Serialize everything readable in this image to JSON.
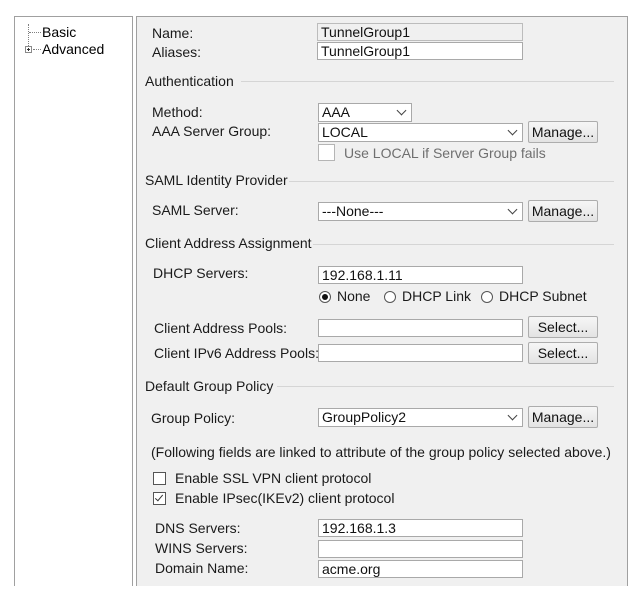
{
  "tree": {
    "items": [
      {
        "label": "Basic",
        "expandable": false
      },
      {
        "label": "Advanced",
        "expandable": true
      }
    ]
  },
  "form": {
    "name_label": "Name:",
    "name_value": "TunnelGroup1",
    "aliases_label": "Aliases:",
    "aliases_value": "TunnelGroup1",
    "authentication": {
      "section_title": "Authentication",
      "method_label": "Method:",
      "method_value": "AAA",
      "server_group_label": "AAA Server Group:",
      "server_group_value": "LOCAL",
      "manage_label": "Manage...",
      "use_local_label": "Use LOCAL if Server Group fails",
      "use_local_checked": false
    },
    "saml": {
      "section_title": "SAML Identity Provider",
      "server_label": "SAML Server:",
      "server_value": "---None---",
      "manage_label": "Manage..."
    },
    "client_address": {
      "section_title": "Client Address Assignment",
      "dhcp_label": "DHCP Servers:",
      "dhcp_value": "192.168.1.11",
      "radio_options": [
        "None",
        "DHCP Link",
        "DHCP Subnet"
      ],
      "radio_selected": "None",
      "pools_label": "Client Address Pools:",
      "pools_value": "",
      "ipv6_pools_label": "Client IPv6 Address Pools:",
      "ipv6_pools_value": "",
      "select_label": "Select..."
    },
    "group_policy": {
      "section_title": "Default Group Policy",
      "policy_label": "Group Policy:",
      "policy_value": "GroupPolicy2",
      "manage_label": "Manage...",
      "note": "(Following fields are linked to attribute of the group policy selected above.)",
      "ssl_label": "Enable SSL VPN client protocol",
      "ssl_checked": false,
      "ipsec_label": "Enable IPsec(IKEv2) client protocol",
      "ipsec_checked": true,
      "dns_label": "DNS Servers:",
      "dns_value": "192.168.1.3",
      "wins_label": "WINS Servers:",
      "wins_value": "",
      "domain_label": "Domain Name:",
      "domain_value": "acme.org"
    }
  }
}
